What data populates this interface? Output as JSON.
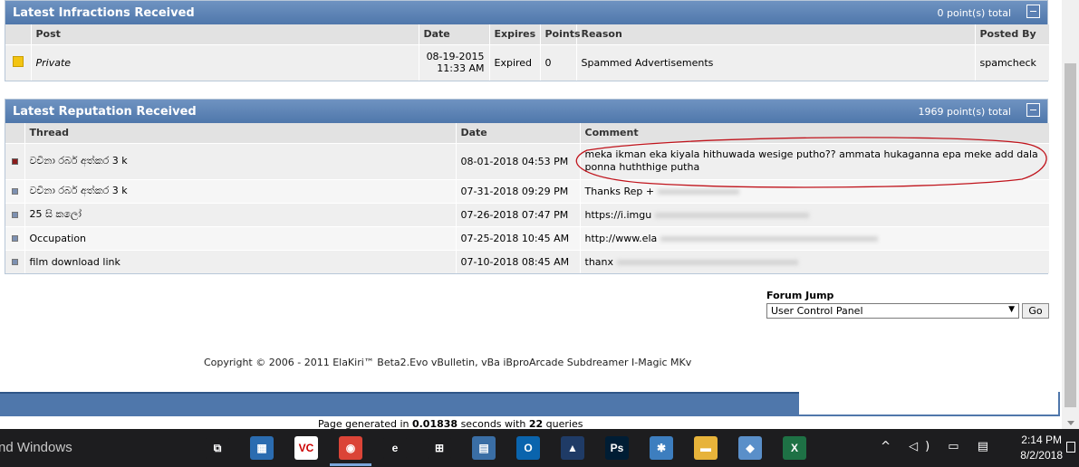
{
  "infractions": {
    "title": "Latest Infractions Received",
    "total": "0 point(s) total",
    "headers": [
      "Post",
      "Date",
      "Expires",
      "Points",
      "Reason",
      "Posted By"
    ],
    "rows": [
      {
        "post": "Private",
        "date_line1": "08-19-2015",
        "date_line2": "11:33 AM",
        "expires": "Expired",
        "points": "0",
        "reason": "Spammed Advertisements",
        "posted_by": "spamcheck"
      }
    ]
  },
  "reputation": {
    "title": "Latest Reputation Received",
    "total": "1969 point(s) total",
    "headers": [
      "Thread",
      "Date",
      "Comment"
    ],
    "rows": [
      {
        "thread": "වචිනා රබර් අත්කර 3 k",
        "date": "08-01-2018 04:53 PM",
        "comment": "meka ikman eka kiyala hithuwada wesige putho?? ammata hukaganna epa meke add dala ponna huththige putha",
        "marker": "red"
      },
      {
        "thread": "වචිනා රබර් අත්කර 3 k",
        "date": "07-31-2018 09:29 PM",
        "comment": "Thanks Rep +",
        "marker": "blue"
      },
      {
        "thread": "25 සි කලෝ",
        "date": "07-26-2018 07:47 PM",
        "comment": "https://i.imgu",
        "marker": "blue"
      },
      {
        "thread": "Occupation",
        "date": "07-25-2018 10:45 AM",
        "comment": "http://www.ela",
        "marker": "blue"
      },
      {
        "thread": "film download link",
        "date": "07-10-2018 08:45 AM",
        "comment": "thanx",
        "marker": "blue"
      }
    ]
  },
  "forum_jump": {
    "label": "Forum Jump",
    "selected": "User Control Panel",
    "go": "Go"
  },
  "copyright": "Copyright © 2006 - 2011 ElaKiri™ Beta2.Evo vBulletin, vBa iBproArcade Subdreamer I-Magic MKv",
  "generated": {
    "prefix": "Page generated in ",
    "seconds": "0.01838",
    "middle": " seconds with ",
    "queries": "22",
    "suffix": " queries"
  },
  "taskbar": {
    "activate_text": "nd Windows",
    "icons": [
      {
        "name": "task-view-icon",
        "label": "⧉",
        "color": "#1d1d1f"
      },
      {
        "name": "calculator-icon",
        "label": "▦",
        "color": "#2b6cb0"
      },
      {
        "name": "vectr-icon",
        "label": "VC",
        "color": "#ffffff"
      },
      {
        "name": "chrome-icon",
        "label": "◉",
        "color": "#db4437"
      },
      {
        "name": "edge-icon",
        "label": "e",
        "color": "#1d1d1f"
      },
      {
        "name": "store-icon",
        "label": "⊞",
        "color": "#1d1d1f"
      },
      {
        "name": "network-tool-icon",
        "label": "▤",
        "color": "#3a6ea5"
      },
      {
        "name": "outlook-icon",
        "label": "O",
        "color": "#0a64ad"
      },
      {
        "name": "mountain-app-icon",
        "label": "▲",
        "color": "#1f3b66"
      },
      {
        "name": "photoshop-icon",
        "label": "Ps",
        "color": "#001d34"
      },
      {
        "name": "settings-app-icon",
        "label": "✱",
        "color": "#3d7ebf"
      },
      {
        "name": "file-explorer-icon",
        "label": "▬",
        "color": "#e7b33a"
      },
      {
        "name": "notepad-icon",
        "label": "◆",
        "color": "#5a8fc9"
      },
      {
        "name": "excel-icon",
        "label": "X",
        "color": "#1e7145"
      }
    ],
    "tray": "^ ◁) ▭ ▤",
    "time": "2:14 PM",
    "date": "8/2/2018"
  }
}
